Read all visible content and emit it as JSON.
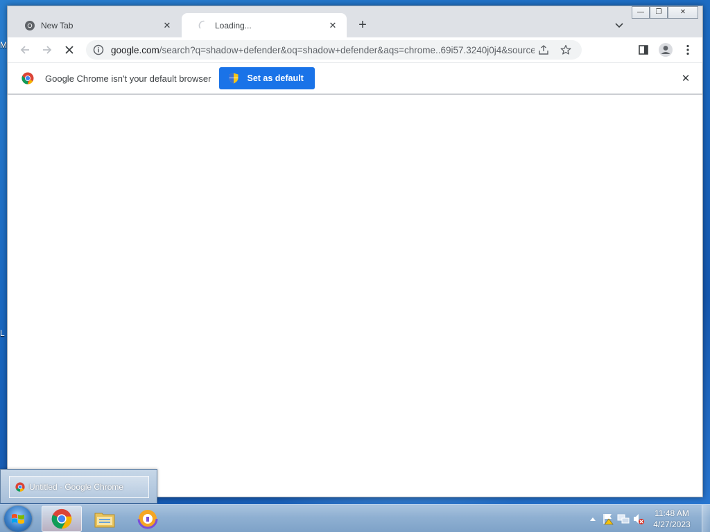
{
  "desktop": {
    "left_fragment_1": "M",
    "left_fragment_2": "L"
  },
  "window_controls": {
    "minimize": "—",
    "restore": "❐",
    "close": "✕"
  },
  "browser": {
    "tabs": [
      {
        "title": "New Tab",
        "active": false
      },
      {
        "title": "Loading...",
        "active": true
      }
    ],
    "new_tab_icon": "plus-icon",
    "url": {
      "host": "google.com",
      "path": "/search?q=shadow+defender&oq=shadow+defender&aqs=chrome..69i57.3240j0j4&sourceid=..."
    },
    "infobar": {
      "message": "Google Chrome isn't your default browser",
      "button_label": "Set as default"
    }
  },
  "taskbar": {
    "pinned": [
      "chrome-icon",
      "windows-explorer-icon",
      "app-icon"
    ],
    "thumbnail_title": "Untitled - Google Chrome",
    "clock": {
      "time": "11:48 AM",
      "date": "4/27/2023"
    }
  },
  "colors": {
    "accent": "#1a73e8",
    "taskbar": "#8fb0d2"
  }
}
